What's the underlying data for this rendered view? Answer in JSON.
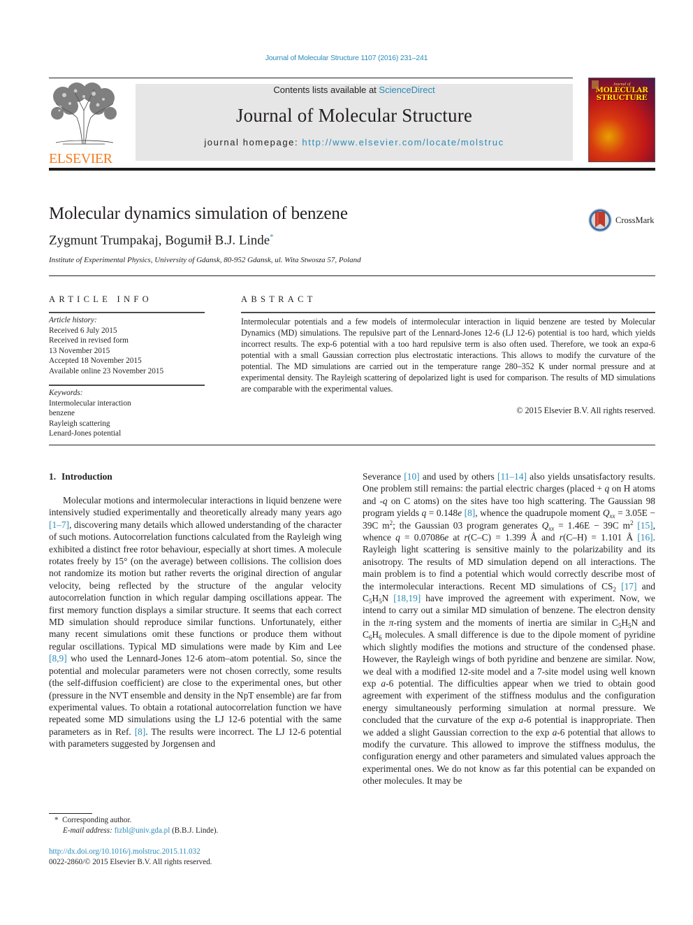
{
  "header": {
    "citation": "Journal of Molecular Structure 1107 (2016) 231–241",
    "contents_prefix": "Contents lists available at ",
    "contents_link": "ScienceDirect",
    "journal_title": "Journal of Molecular Structure",
    "homepage_prefix": "journal homepage: ",
    "homepage_url": "http://www.elsevier.com/locate/molstruc",
    "publisher_logo_text": "ELSEVIER",
    "cover": {
      "subtitle": "Journal of",
      "title_line1": "MOLECULAR",
      "title_line2": "STRUCTURE"
    },
    "colors": {
      "link": "#2a8bb8",
      "elsevier_orange": "#f47b20",
      "banner_bg": "#e6e6e6"
    }
  },
  "article": {
    "title": "Molecular dynamics simulation of benzene",
    "authors": "Zygmunt Trumpakaj, Bogumił B.J. Linde",
    "author_mark": "*",
    "affiliation": "Institute of Experimental Physics, University of Gdansk, 80-952 Gdansk, ul. Wita Stwosza 57, Poland",
    "crossmark_label": "CrossMark"
  },
  "article_info": {
    "heading": "ARTICLE INFO",
    "history_label": "Article history:",
    "history": [
      "Received 6 July 2015",
      "Received in revised form",
      "13 November 2015",
      "Accepted 18 November 2015",
      "Available online 23 November 2015"
    ],
    "keywords_label": "Keywords:",
    "keywords": [
      "Intermolecular interaction",
      "benzene",
      "Rayleigh scattering",
      "Lenard-Jones potential"
    ]
  },
  "abstract": {
    "heading": "ABSTRACT",
    "p1": "Intermolecular potentials and a few models of intermolecular interaction in liquid benzene are tested by Molecular Dynamics (MD) simulations. The repulsive part of the Lennard-Jones 12-6 (LJ 12-6) potential is too hard, which yields incorrect results. The exp-6 potential with a too hard repulsive term is also often used. Therefore, we took an exp",
    "p1_italic": "a",
    "p2": "-6 potential with a small Gaussian correction plus electrostatic interactions. This allows to modify the curvature of the potential. The MD simulations are carried out in the temperature range 280–352 K under normal pressure and at experimental density. The Rayleigh scattering of depolarized light is used for comparison. The results of MD simulations are comparable with the experimental values.",
    "copyright": "© 2015 Elsevier B.V. All rights reserved."
  },
  "intro": {
    "number": "1.",
    "heading": "Introduction",
    "left": {
      "s1": "Molecular motions and intermolecular interactions in liquid benzene were intensively studied experimentally and theoretically already many years ago ",
      "ref1": "[1–7]",
      "s2": ", discovering many details which allowed understanding of the character of such motions. Autocorrelation functions calculated from the Rayleigh wing exhibited a distinct free rotor behaviour, especially at short times. A molecule rotates freely by 15° (on the average) between collisions. The collision does not randomize its motion but rather reverts the original direction of angular velocity, being reflected by the structure of the angular velocity autocorrelation function in which regular damping oscillations appear. The first memory function displays a similar structure. It seems that each correct MD simulation should reproduce similar functions. Unfortunately, either many recent simulations omit these functions or produce them without regular oscillations. Typical MD simulations were made by Kim and Lee ",
      "ref2": "[8,9]",
      "s3": " who used the Lennard-Jones 12-6 atom–atom potential. So, since the potential and molecular parameters were not chosen correctly, some results (the self-diffusion coefficient) are close to the experimental ones, but other (pressure in the NVT ensemble and density in the NpT ensemble) are far from experimental values. To obtain a rotational autocorrelation function we have repeated some MD simulations using the LJ 12-6 potential with the same parameters as in Ref. ",
      "ref3": "[8]",
      "s4": ". The results were incorrect. The LJ 12-6 potential with parameters suggested by Jorgensen and"
    },
    "right": {
      "s1": "Severance ",
      "ref1": "[10]",
      "s2": " and used by others ",
      "ref2": "[11–14]",
      "s3": " also yields unsatisfactory results. One problem still remains: the partial electric charges (placed + ",
      "q1": "q",
      "s4": " on H atoms and -",
      "q2": "q",
      "s5": " on C atoms) on the sites have too high scattering. The Gaussian 98 program yields ",
      "q3": "q",
      "s6": " = 0.148",
      "e1": "e",
      "s6b": " ",
      "ref3": "[8]",
      "s7": ", whence the quadrupole moment ",
      "Q1": "Q",
      "xx1": "xx",
      "s8": " = 3.05E − 39C m",
      "sq1": "2",
      "s9": "; the Gaussian 03 program generates ",
      "Q2": "Q",
      "xx2": "xx",
      "s10": " = 1.46E − 39C m",
      "sq2": "2",
      "s10b": " ",
      "ref4": "[15]",
      "s11": ", whence ",
      "q4": "q",
      "s12": " = 0.07086",
      "e2": "e",
      "s13": " at ",
      "r1": "r",
      "s14": "(C–C) = 1.399 Å and ",
      "r2": "r",
      "s15": "(C–H) = 1.101 Å ",
      "ref5": "[16]",
      "s16": ". Rayleigh light scattering is sensitive mainly to the polarizability and its anisotropy. The results of MD simulation depend on all interactions. The main problem is to find a potential which would correctly describe most of the intermolecular interactions. Recent MD simulations of CS",
      "sub1": "2",
      "s17": " ",
      "ref6": "[17]",
      "s18": " and C",
      "sub2": "5",
      "s19": "H",
      "sub3": "5",
      "s20": "N ",
      "ref7": "[18,19]",
      "s21": " have improved the agreement with experiment. Now, we intend to carry out a similar MD simulation of benzene. The electron density in the ",
      "pi": "π",
      "s22": "-ring system and the moments of inertia are similar in C",
      "sub4": "5",
      "s23": "H",
      "sub5": "5",
      "s24": "N and C",
      "sub6": "6",
      "s25": "H",
      "sub7": "6",
      "s26": " molecules. A small difference is due to the dipole moment of pyridine which slightly modifies the motions and structure of the condensed phase. However, the Rayleigh wings of both pyridine and benzene are similar. Now, we deal with a modified 12-site model and a 7-site model using well known exp ",
      "a1": "a",
      "s27": "-6 potential. The difficulties appear when we tried to obtain good agreement with experiment of the stiffness modulus and the configuration energy simultaneously performing simulation at normal pressure. We concluded that the curvature of the exp ",
      "a2": "a",
      "s28": "-6 potential is inappropriate. Then we added a slight Gaussian correction to the exp ",
      "a3": "a",
      "s29": "-6 potential that allows to modify the curvature. This allowed to improve the stiffness modulus, the configuration energy and other parameters and simulated values approach the experimental ones. We do not know as far this potential can be expanded on other molecules. It may be"
    }
  },
  "footnotes": {
    "mark": "*",
    "corresponding": "Corresponding author.",
    "email_label": "E-mail address:",
    "email": "fizbl@univ.gda.pl",
    "email_owner": " (B.B.J. Linde).",
    "doi": "http://dx.doi.org/10.1016/j.molstruc.2015.11.032",
    "issn": "0022-2860/© 2015 Elsevier B.V. All rights reserved."
  }
}
